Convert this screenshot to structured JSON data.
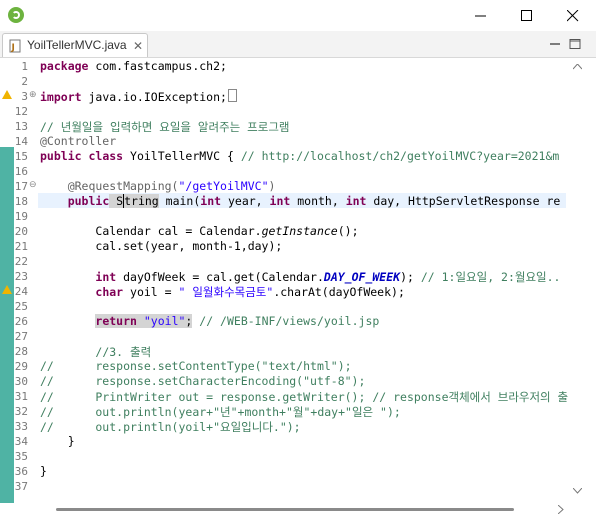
{
  "window": {
    "app_icon": "spring-leaf-icon",
    "controls": [
      "minimize-icon",
      "maximize-icon",
      "close-icon"
    ]
  },
  "tab": {
    "label": "YoilTellerMVC.java",
    "close_glyph": "✕",
    "icon": "java-file-icon"
  },
  "editor": {
    "line_numbers": [
      "1",
      "2",
      "3",
      "12",
      "13",
      "14",
      "15",
      "16",
      "17",
      "18",
      "19",
      "20",
      "21",
      "22",
      "23",
      "24",
      "25",
      "26",
      "27",
      "28",
      "29",
      "30",
      "31",
      "32",
      "33",
      "34",
      "35",
      "36",
      "37"
    ],
    "lines": {
      "l1_kw": "package",
      "l1_rest": " com.fastcampus.ch2;",
      "l3_kw": "import",
      "l3_rest": " java.io.IOException;",
      "l13": "// 년월일을 입력하면 요일을 알려주는 프로그램",
      "l14": "@Controller",
      "l15_kw1": "public",
      "l15_kw2": "class",
      "l15_name": " YoilTellerMVC { ",
      "l15_cm": "// http://localhost/ch2/getYoilMVC?year=2021&m",
      "l17_ann": "@RequestMapping(",
      "l17_str": "\"/getYoilMVC\"",
      "l17_end": ")",
      "l18_kw": "public",
      "l18_a": " S",
      "l18_b": "tring",
      "l18_c": " main(",
      "l18_int1": "int",
      "l18_d": " year, ",
      "l18_int2": "int",
      "l18_e": " month, ",
      "l18_int3": "int",
      "l18_f": " day, HttpServletResponse re",
      "l20_a": "Calendar cal = Calendar.",
      "l20_b": "getInstance",
      "l20_c": "();",
      "l21": "cal.set(year, month-1,day);",
      "l23_kw": "int",
      "l23_a": " dayOfWeek = cal.get(Calendar.",
      "l23_fld": "DAY_OF_WEEK",
      "l23_b": "); ",
      "l23_cm": "// 1:일요일, 2:월요일..",
      "l24_kw": "char",
      "l24_a": " yoil = ",
      "l24_str": "\" 일월화수목금토\"",
      "l24_b": ".charAt(dayOfWeek);",
      "l26_kw": "return",
      "l26_str": "\"yoil\"",
      "l26_semi": ";",
      "l26_cm": " // /WEB-INF/views/yoil.jsp",
      "l28": "//3. 출력",
      "l29": "//      response.setContentType(\"text/html\");",
      "l30": "//      response.setCharacterEncoding(\"utf-8\");",
      "l31": "//      PrintWriter out = response.getWriter(); // response객체에서 브라우저의 출",
      "l32": "//      out.println(year+\"년\"+month+\"월\"+day+\"일은 \");",
      "l33": "//      out.println(yoil+\"요일입니다.\");",
      "l34": "}",
      "l36": "}"
    }
  },
  "colors": {
    "keyword": "#7f0055",
    "comment": "#3f7f5f",
    "string": "#2a00ff",
    "annotation": "#646464",
    "quick_diff": "#4fb3a4",
    "current_line": "#e8f2fe"
  }
}
